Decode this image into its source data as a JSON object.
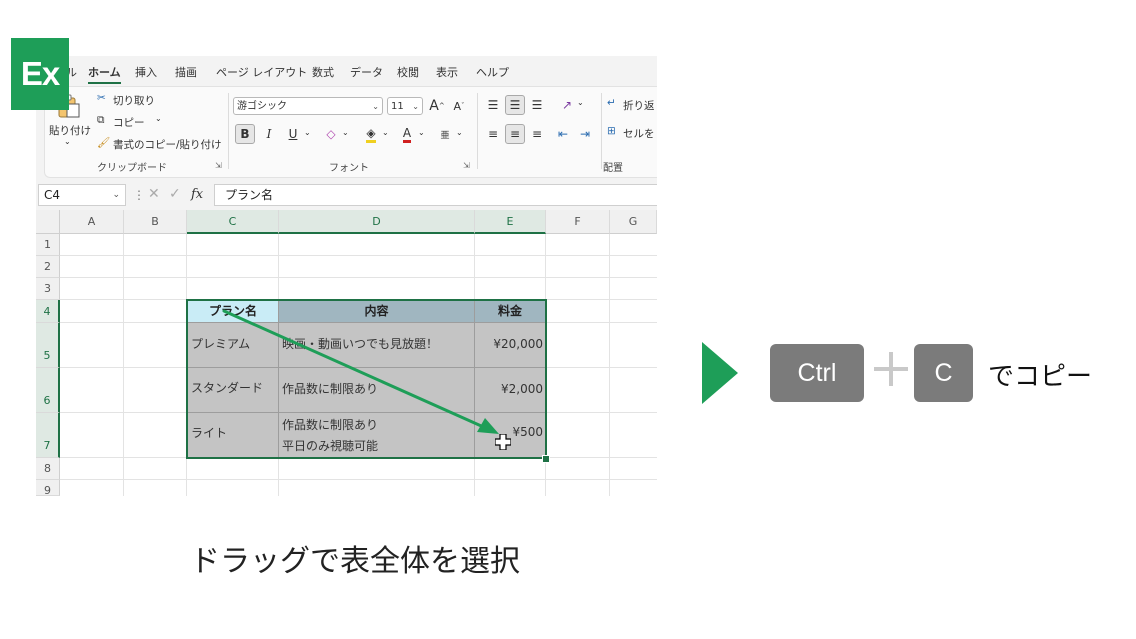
{
  "badge": "Ex",
  "ribbon": {
    "tabs": [
      "ル",
      "ホーム",
      "挿入",
      "描画",
      "ページ レイアウト",
      "数式",
      "データ",
      "校閲",
      "表示",
      "ヘルプ"
    ],
    "active_tab": "ホーム",
    "clipboard": {
      "paste_label": "貼り付け",
      "cut_label": "切り取り",
      "copy_label": "コピー",
      "format_painter_label": "書式のコピー/貼り付け",
      "group_label": "クリップボード"
    },
    "font": {
      "font_name": "游ゴシック",
      "font_size": "11",
      "grow_label": "A",
      "shrink_label": "A",
      "bold": "B",
      "italic": "I",
      "underline": "U",
      "font_color": "A",
      "group_label": "フォント"
    },
    "alignment": {
      "wrap_label": "折り返",
      "merge_label": "セルを",
      "group_label": "配置"
    }
  },
  "formula_bar": {
    "name_box": "C4",
    "fx": "fx",
    "formula": "プラン名"
  },
  "grid": {
    "columns": [
      "A",
      "B",
      "C",
      "D",
      "E",
      "F",
      "G"
    ],
    "rows": [
      "1",
      "2",
      "3",
      "4",
      "5",
      "6",
      "7",
      "8",
      "9"
    ],
    "table": {
      "headers": [
        "プラン名",
        "内容",
        "料金"
      ],
      "rows": [
        {
          "plan": "プレミアム",
          "content1": "映画・動画いつでも見放題！",
          "content2": "",
          "price": "¥20,000"
        },
        {
          "plan": "スタンダード",
          "content1": "作品数に制限あり",
          "content2": "",
          "price": "¥2,000"
        },
        {
          "plan": "ライト",
          "content1": "作品数に制限あり",
          "content2": "平日のみ視聴可能",
          "price": "¥500"
        }
      ]
    }
  },
  "shortcut": {
    "key1": "Ctrl",
    "key2": "C",
    "label": "でコピー"
  },
  "caption": "ドラッグで表全体を選択",
  "colors": {
    "accent": "#1e9e58",
    "selection": "#1e7145",
    "key": "#7b7b7b"
  }
}
